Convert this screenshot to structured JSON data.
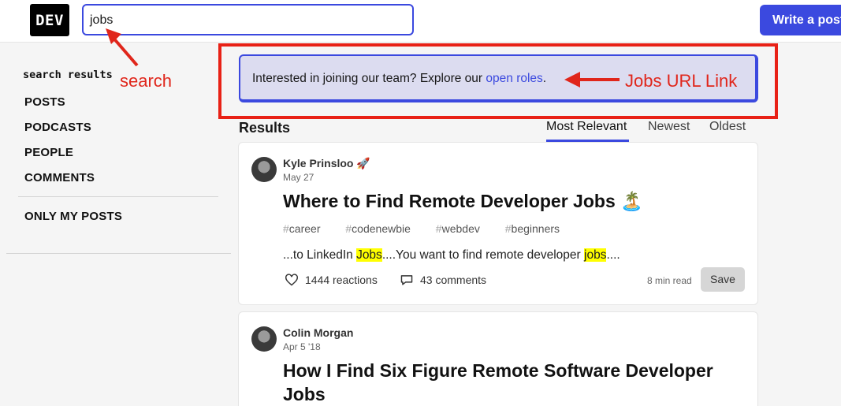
{
  "header": {
    "logo": "DEV",
    "search_value": "jobs",
    "write_button": "Write a post"
  },
  "sidebar": {
    "heading": "search results",
    "items": [
      {
        "label": "POSTS"
      },
      {
        "label": "PODCASTS"
      },
      {
        "label": "PEOPLE"
      },
      {
        "label": "COMMENTS"
      }
    ],
    "my_posts": "ONLY MY POSTS"
  },
  "annotations": {
    "search": "search",
    "jobs_link": "Jobs URL Link",
    "color": "#e0261b"
  },
  "banner": {
    "prefix": "Interested in joining our team? Explore our ",
    "link": "open roles",
    "suffix": "."
  },
  "results": {
    "title": "Results",
    "tabs": [
      {
        "label": "Most Relevant",
        "active": true
      },
      {
        "label": "Newest",
        "active": false
      },
      {
        "label": "Oldest",
        "active": false
      }
    ]
  },
  "posts": [
    {
      "author": "Kyle Prinsloo 🚀",
      "date": "May 27",
      "title": "Where to Find Remote Developer Jobs 🏝️",
      "tags": [
        "career",
        "codenewbie",
        "webdev",
        "beginners"
      ],
      "snippet_1": "...to LinkedIn ",
      "snippet_hl_1": "Jobs",
      "snippet_2": "....You want to find remote developer ",
      "snippet_hl_2": "jobs",
      "snippet_3": "....",
      "reactions": "1444 reactions",
      "comments": "43 comments",
      "read_time": "8 min read",
      "save": "Save"
    },
    {
      "author": "Colin Morgan",
      "date": "Apr 5 '18",
      "title_line1": "How I Find Six Figure Remote Software Developer",
      "title_line2": "Jobs"
    }
  ],
  "colors": {
    "accent": "#3b49df",
    "highlight": "#ffff00",
    "annotation_box": "#e82116"
  }
}
